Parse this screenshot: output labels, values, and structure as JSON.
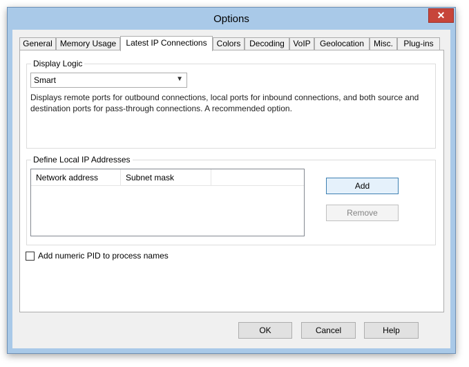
{
  "window": {
    "title": "Options",
    "close_icon": "✕"
  },
  "tabs": [
    {
      "label": "General"
    },
    {
      "label": "Memory Usage"
    },
    {
      "label": "Latest IP Connections"
    },
    {
      "label": "Colors"
    },
    {
      "label": "Decoding"
    },
    {
      "label": "VoIP"
    },
    {
      "label": "Geolocation"
    },
    {
      "label": "Misc."
    },
    {
      "label": "Plug-ins"
    }
  ],
  "display_logic": {
    "group_label": "Display Logic",
    "selected": "Smart",
    "description": "Displays remote ports for outbound connections, local ports for inbound connections, and both source and destination ports for pass-through connections. A recommended option."
  },
  "local_ip": {
    "group_label": "Define Local IP Addresses",
    "columns": [
      "Network address",
      "Subnet mask"
    ],
    "add_label": "Add",
    "remove_label": "Remove"
  },
  "pid_checkbox": {
    "label": "Add numeric PID to process names",
    "checked": false
  },
  "footer": {
    "ok_label": "OK",
    "cancel_label": "Cancel",
    "help_label": "Help"
  }
}
